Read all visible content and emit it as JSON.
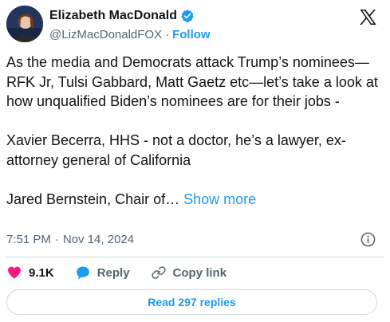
{
  "author": {
    "display_name": "Elizabeth MacDonald",
    "handle": "@LizMacDonaldFOX",
    "separator": "·",
    "follow_label": "Follow",
    "verified": true
  },
  "tweet": {
    "text": "As the media and Democrats attack Trump’s nominees—RFK Jr, Tulsi Gabbard, Matt Gaetz etc—let’s take a look at how unqualified Biden’s nominees are for their jobs -\n\nXavier Becerra, HHS - not a doctor, he’s a lawyer, ex-attorney general of California\n\nJared Bernstein, Chair of…",
    "show_more_label": "Show more",
    "time": "7:51 PM",
    "date_separator": "·",
    "date": "Nov 14, 2024"
  },
  "actions": {
    "likes_count": "9.1K",
    "reply_label": "Reply",
    "copy_link_label": "Copy link"
  },
  "replies": {
    "read_label": "Read 297 replies"
  },
  "colors": {
    "link": "#1d9bf0",
    "text": "#0f1419",
    "secondary": "#536471",
    "like": "#f91880",
    "border": "#cfd9de"
  },
  "icons": [
    "x-logo-icon",
    "verified-badge-icon",
    "info-icon",
    "heart-icon",
    "reply-bubble-icon",
    "link-icon"
  ]
}
